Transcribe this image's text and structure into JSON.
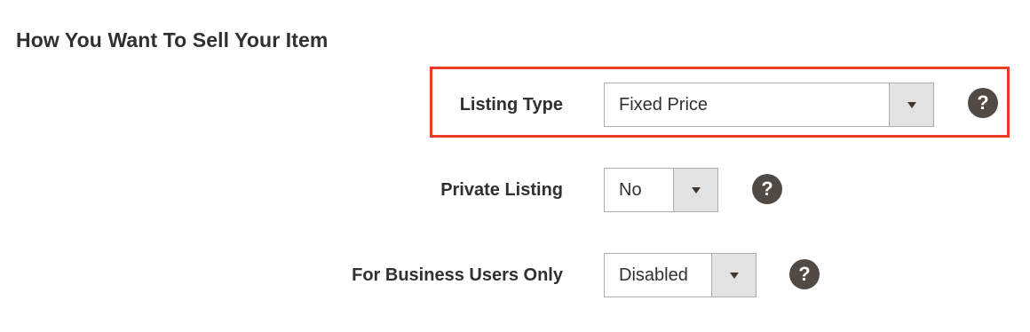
{
  "section": {
    "title": "How You Want To Sell Your Item"
  },
  "fields": {
    "listing_type": {
      "label": "Listing Type",
      "value": "Fixed Price"
    },
    "private_listing": {
      "label": "Private Listing",
      "value": "No"
    },
    "business_only": {
      "label": "For Business Users Only",
      "value": "Disabled"
    }
  },
  "help_glyph": "?",
  "colors": {
    "highlight_border": "#eb3b24",
    "help_icon": "#514943",
    "select_arrow_bg": "#e3e3e3"
  },
  "icons": {
    "help": "question-circle-icon",
    "dropdown": "caret-down-icon"
  }
}
